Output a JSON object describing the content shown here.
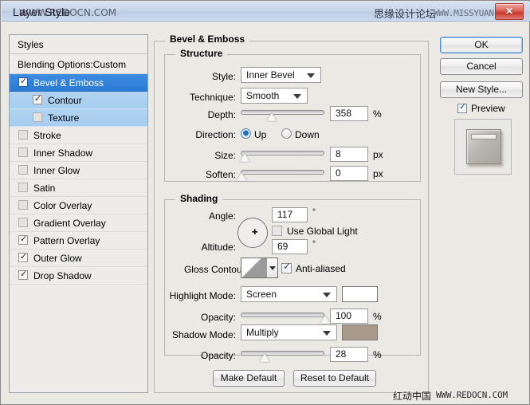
{
  "window": {
    "title": "Layer Style",
    "close_label": "✕"
  },
  "watermarks": {
    "title_overlay": "WWW.REDOCN.COM",
    "top_cn": "思缘设计论坛",
    "top_en": "WWW.MISSYUAN.COM",
    "bottom_cn": "红动中国",
    "bottom_en": "WWW.REDOCN.COM"
  },
  "styles_panel": {
    "header": "Styles",
    "blending_options": "Blending Options:Custom",
    "items": [
      {
        "label": "Bevel & Emboss",
        "checked": true,
        "selected": true,
        "level": 0,
        "check_mark": "✓"
      },
      {
        "label": "Contour",
        "checked": true,
        "selected": false,
        "level": 1,
        "check_mark": "✓"
      },
      {
        "label": "Texture",
        "checked": false,
        "selected": false,
        "level": 1,
        "check_mark": ""
      },
      {
        "label": "Stroke",
        "checked": false,
        "selected": false,
        "level": 0,
        "check_mark": ""
      },
      {
        "label": "Inner Shadow",
        "checked": false,
        "selected": false,
        "level": 0,
        "check_mark": ""
      },
      {
        "label": "Inner Glow",
        "checked": false,
        "selected": false,
        "level": 0,
        "check_mark": ""
      },
      {
        "label": "Satin",
        "checked": false,
        "selected": false,
        "level": 0,
        "check_mark": ""
      },
      {
        "label": "Color Overlay",
        "checked": false,
        "selected": false,
        "level": 0,
        "check_mark": ""
      },
      {
        "label": "Gradient Overlay",
        "checked": false,
        "selected": false,
        "level": 0,
        "check_mark": ""
      },
      {
        "label": "Pattern Overlay",
        "checked": true,
        "selected": false,
        "level": 0,
        "check_mark": "✓"
      },
      {
        "label": "Outer Glow",
        "checked": true,
        "selected": false,
        "level": 0,
        "check_mark": "✓"
      },
      {
        "label": "Drop Shadow",
        "checked": true,
        "selected": false,
        "level": 0,
        "check_mark": "✓"
      }
    ]
  },
  "buttons": {
    "ok": "OK",
    "cancel": "Cancel",
    "new_style": "New Style...",
    "make_default": "Make Default",
    "reset_default": "Reset to Default"
  },
  "preview": {
    "label": "Preview",
    "checked": true,
    "check_mark": "✓"
  },
  "panel": {
    "title": "Bevel & Emboss",
    "structure": {
      "title": "Structure",
      "style_label": "Style:",
      "style_value": "Inner Bevel",
      "technique_label": "Technique:",
      "technique_value": "Smooth",
      "depth_label": "Depth:",
      "depth_value": "358",
      "depth_unit": "%",
      "depth_percent": 36,
      "direction_label": "Direction:",
      "direction_up": "Up",
      "direction_down": "Down",
      "direction_selected": "Up",
      "size_label": "Size:",
      "size_value": "8",
      "size_unit": "px",
      "size_percent": 4,
      "soften_label": "Soften:",
      "soften_value": "0",
      "soften_unit": "px",
      "soften_percent": 0
    },
    "shading": {
      "title": "Shading",
      "angle_label": "Angle:",
      "angle_value": "117",
      "angle_unit": "°",
      "use_global_light_label": "Use Global Light",
      "use_global_light_checked": false,
      "altitude_label": "Altitude:",
      "altitude_value": "69",
      "altitude_unit": "°",
      "gloss_contour_label": "Gloss Contour:",
      "anti_aliased_label": "Anti-aliased",
      "anti_aliased_checked": true,
      "anti_aliased_mark": "✓",
      "highlight_mode_label": "Highlight Mode:",
      "highlight_mode_value": "Screen",
      "highlight_color": "#ffffff",
      "highlight_opacity_label": "Opacity:",
      "highlight_opacity_value": "100",
      "highlight_opacity_unit": "%",
      "highlight_opacity_percent": 100,
      "shadow_mode_label": "Shadow Mode:",
      "shadow_mode_value": "Multiply",
      "shadow_color": "#a89b8c",
      "shadow_opacity_label": "Opacity:",
      "shadow_opacity_value": "28",
      "shadow_opacity_unit": "%",
      "shadow_opacity_percent": 28
    }
  }
}
